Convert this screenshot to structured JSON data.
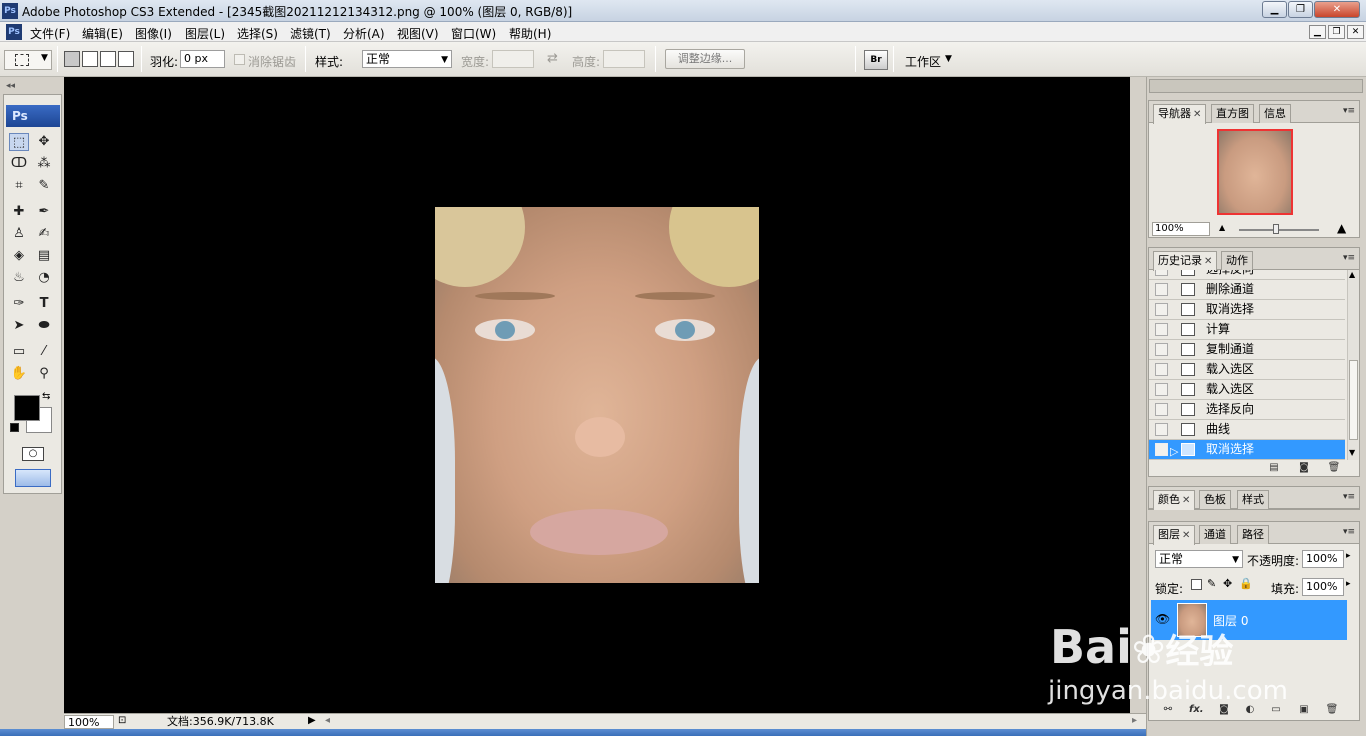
{
  "window": {
    "title": "Adobe Photoshop CS3 Extended - [2345截图20211212134312.png @ 100% (图层 0, RGB/8)]",
    "app_icon": "Ps"
  },
  "menu": {
    "items": [
      "文件(F)",
      "编辑(E)",
      "图像(I)",
      "图层(L)",
      "选择(S)",
      "滤镜(T)",
      "分析(A)",
      "视图(V)",
      "窗口(W)",
      "帮助(H)"
    ]
  },
  "options": {
    "feather_label": "羽化:",
    "feather_value": "0 px",
    "antialias_label": "消除锯齿",
    "style_label": "样式:",
    "style_value": "正常",
    "width_label": "宽度:",
    "height_label": "高度:",
    "refine_edge_label": "调整边缘...",
    "workspace_label": "工作区"
  },
  "tools": {
    "panel_logo": "Ps",
    "type_tool_glyph": "T"
  },
  "status": {
    "zoom": "100%",
    "doc_size": "文档:356.9K/713.8K"
  },
  "navigator": {
    "tabs": [
      "导航器",
      "直方图",
      "信息"
    ],
    "zoom": "100%"
  },
  "history": {
    "tabs": [
      "历史记录",
      "动作"
    ],
    "items": [
      "选择反向",
      "删除通道",
      "取消选择",
      "计算",
      "复制通道",
      "载入选区",
      "载入选区",
      "选择反向",
      "曲线",
      "取消选择"
    ],
    "selected_index": 9
  },
  "color_panel": {
    "tabs": [
      "颜色",
      "色板",
      "样式"
    ]
  },
  "layers": {
    "tabs": [
      "图层",
      "通道",
      "路径"
    ],
    "blend_mode": "正常",
    "opacity_label": "不透明度:",
    "opacity_value": "100%",
    "lock_label": "锁定:",
    "fill_label": "填充:",
    "fill_value": "100%",
    "layer_name": "图层 0",
    "footer_fx": "fx."
  },
  "watermark": {
    "brand": "Bai",
    "brand_cn": "经验",
    "url": "jingyan.baidu.com"
  },
  "colors": {
    "selection_blue": "#3399ff",
    "canvas_bg": "#000000"
  }
}
